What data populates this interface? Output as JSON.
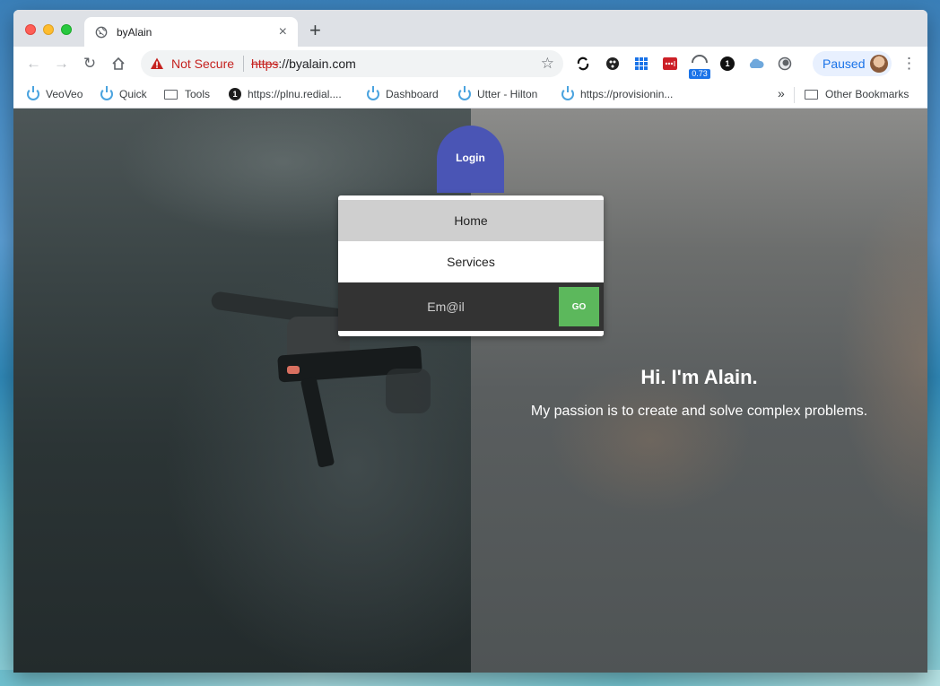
{
  "browser": {
    "tab_title": "byAlain",
    "new_tab_label": "+",
    "security_label": "Not Secure",
    "url_protocol": "https",
    "url_rest": "://byalain.com",
    "profile_label": "Paused",
    "extension_badge": "0.73"
  },
  "bookmarks": {
    "items": [
      {
        "label": "VeoVeo",
        "icon": "power-icon"
      },
      {
        "label": "Quick",
        "icon": "power-icon"
      },
      {
        "label": "Tools",
        "icon": "folder-icon"
      },
      {
        "label": "https://plnu.redial....",
        "icon": "one-icon"
      },
      {
        "label": "Dashboard",
        "icon": "power-icon"
      },
      {
        "label": "Utter - Hilton",
        "icon": "power-icon"
      },
      {
        "label": "https://provisionin...",
        "icon": "power-icon"
      }
    ],
    "overflow_label": "»",
    "other_bookmarks": "Other Bookmarks"
  },
  "site": {
    "login_label": "Login",
    "menu": [
      {
        "label": "Home"
      },
      {
        "label": "Services"
      }
    ],
    "email_placeholder": "Em@il",
    "go_label": "GO",
    "hero_title": "Hi. I'm Alain.",
    "hero_subtitle": "My passion is to create and solve complex problems."
  },
  "colors": {
    "login_tab": "#4a55b5",
    "go_button": "#5cb85c",
    "not_secure": "#c5221f"
  }
}
